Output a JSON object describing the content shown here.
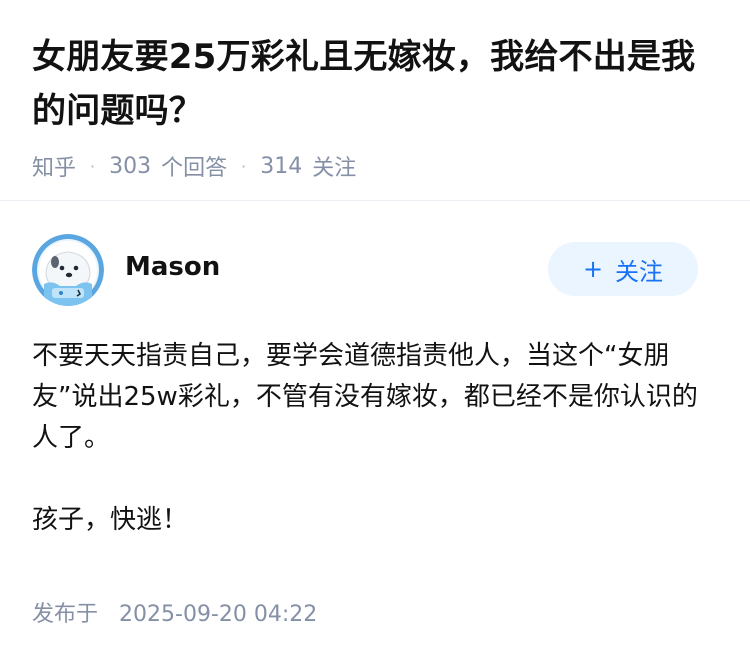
{
  "question": {
    "title": "女朋友要25万彩礼且无嫁妆，我给不出是我的问题吗？",
    "source": "知乎",
    "answer_count": "303",
    "answer_label": "个回答",
    "follower_count": "314",
    "follower_label": "关注",
    "separator": "·"
  },
  "answer": {
    "author": {
      "name": "Mason",
      "avatar_icon": "avatar-image"
    },
    "follow_button": {
      "icon": "+",
      "label": "关注"
    },
    "paragraphs": [
      "不要天天指责自己，要学会道德指责他人，当这个“女朋友”说出25w彩礼，不管有没有嫁妆，都已经不是你认识的人了。",
      "孩子，快逃！"
    ],
    "publish_label": "发布于",
    "publish_time": "2025-09-20 04:22"
  },
  "colors": {
    "meta_gray": "#8590a6",
    "brand_blue": "#1772f6",
    "follow_bg": "#ebf5ff",
    "text": "#121212"
  }
}
